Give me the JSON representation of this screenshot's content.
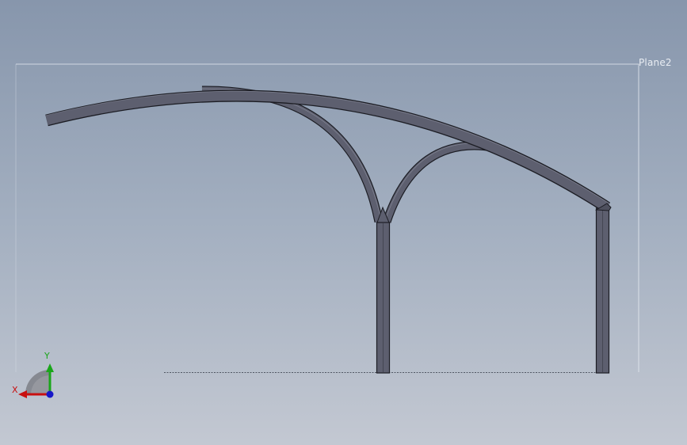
{
  "viewport": {
    "background_top": "#8796ac",
    "background_bottom": "#c3c8d2"
  },
  "model": {
    "beam_fill": "#5d5f6f",
    "beam_edge": "#1c1d24"
  },
  "plane": {
    "label": "Plane2",
    "border_color": "#e6ebf2"
  },
  "triad": {
    "x_label": "X",
    "y_label": "Y",
    "x_color": "#c81010",
    "y_color": "#1aa61a",
    "z_color": "#1717c8"
  }
}
